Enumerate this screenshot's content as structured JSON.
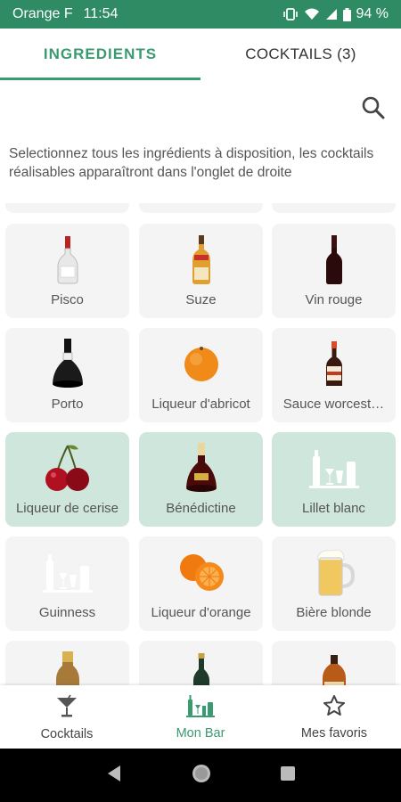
{
  "status_bar": {
    "carrier": "Orange F",
    "time": "11:54",
    "battery": "94 %"
  },
  "tabs": [
    {
      "label": "INGREDIENTS",
      "active": true
    },
    {
      "label": "COCKTAILS (3)",
      "active": false
    }
  ],
  "description": "Selectionnez tous les ingrédients à disposition, les cocktails réalisables apparaîtront dans l'onglet de droite",
  "ingredients": [
    {
      "label": "Pisco",
      "icon": "pisco-bottle-icon",
      "selected": false
    },
    {
      "label": "Suze",
      "icon": "suze-bottle-icon",
      "selected": false
    },
    {
      "label": "Vin rouge",
      "icon": "red-wine-bottle-icon",
      "selected": false
    },
    {
      "label": "Porto",
      "icon": "porto-bottle-icon",
      "selected": false
    },
    {
      "label": "Liqueur d'abricot",
      "icon": "apricot-icon",
      "selected": false
    },
    {
      "label": "Sauce worcest…",
      "icon": "sauce-bottle-icon",
      "selected": false
    },
    {
      "label": "Liqueur de cerise",
      "icon": "cherry-icon",
      "selected": true
    },
    {
      "label": "Bénédictine",
      "icon": "benedictine-bottle-icon",
      "selected": true
    },
    {
      "label": "Lillet blanc",
      "icon": "bar-placeholder-icon",
      "selected": true
    },
    {
      "label": "Guinness",
      "icon": "bar-placeholder-icon",
      "selected": false
    },
    {
      "label": "Liqueur d'orange",
      "icon": "orange-icon",
      "selected": false
    },
    {
      "label": "Bière blonde",
      "icon": "beer-mug-icon",
      "selected": false
    }
  ],
  "bottom_nav": [
    {
      "label": "Cocktails",
      "icon": "cocktail-glass-icon",
      "active": false
    },
    {
      "label": "Mon Bar",
      "icon": "bar-icon",
      "active": true
    },
    {
      "label": "Mes favoris",
      "icon": "star-icon",
      "active": false
    }
  ],
  "colors": {
    "primary": "#2e8b63",
    "accent": "#3a9a70",
    "selected_card": "#cfe6dc",
    "card": "#f4f4f4"
  }
}
